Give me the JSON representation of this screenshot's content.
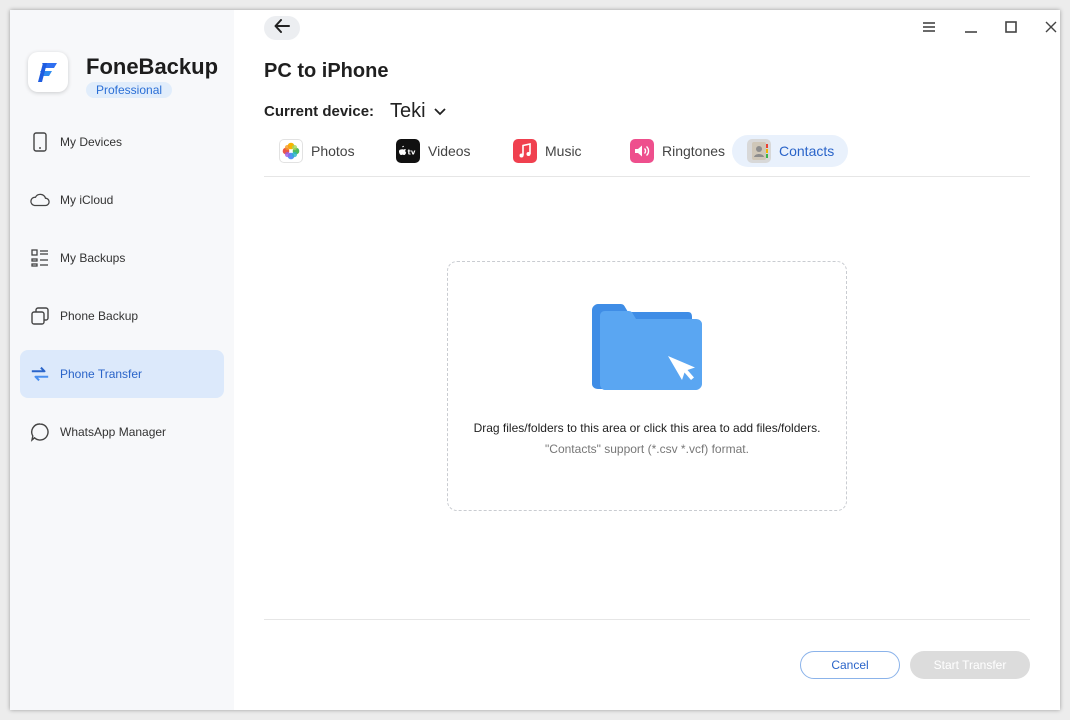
{
  "app": {
    "name": "FoneBackup",
    "edition": "Professional"
  },
  "sidebar": {
    "items": [
      {
        "label": "My Devices",
        "icon": "phone-icon",
        "active": false
      },
      {
        "label": "My iCloud",
        "icon": "cloud-icon",
        "active": false
      },
      {
        "label": "My Backups",
        "icon": "list-icon",
        "active": false
      },
      {
        "label": "Phone Backup",
        "icon": "copy-icon",
        "active": false
      },
      {
        "label": "Phone Transfer",
        "icon": "transfer-arrows-icon",
        "active": true
      },
      {
        "label": "WhatsApp Manager",
        "icon": "chat-bubble-icon",
        "active": false
      }
    ]
  },
  "page": {
    "title": "PC to iPhone",
    "device_label": "Current device:",
    "device_name": "Teki"
  },
  "tabs": [
    {
      "label": "Photos",
      "icon": "photos-icon",
      "active": false
    },
    {
      "label": "Videos",
      "icon": "apple-tv-icon",
      "active": false
    },
    {
      "label": "Music",
      "icon": "music-note-icon",
      "active": false
    },
    {
      "label": "Ringtones",
      "icon": "speaker-icon",
      "active": false
    },
    {
      "label": "Contacts",
      "icon": "contacts-icon",
      "active": true
    }
  ],
  "dropzone": {
    "main_text": "Drag files/folders to this area or click this area to add files/folders.",
    "sub_text": "\"Contacts\" support (*.csv *.vcf) format."
  },
  "footer": {
    "cancel_label": "Cancel",
    "start_label": "Start Transfer"
  },
  "colors": {
    "accent": "#2a64c9",
    "active_bg": "#dce9fb",
    "folder": "#4a9af0"
  }
}
